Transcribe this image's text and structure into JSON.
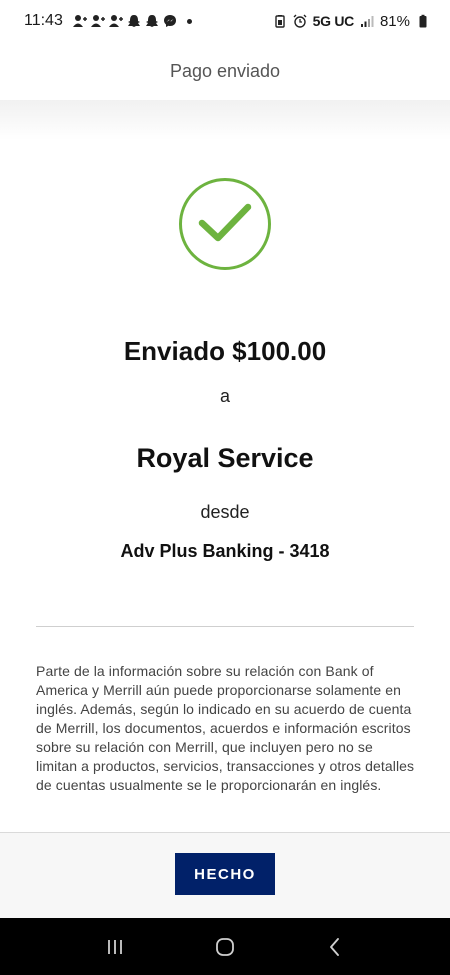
{
  "status_bar": {
    "time": "11:43",
    "network": "5G UC",
    "battery": "81%",
    "notification_icons": [
      "person-add-icon",
      "person-add-icon",
      "person-add-icon",
      "snapchat-icon",
      "snapchat-icon",
      "messenger-icon"
    ]
  },
  "header": {
    "title": "Pago enviado"
  },
  "confirmation": {
    "icon": "checkmark-circle-icon",
    "sent_amount": "Enviado $100.00",
    "to_word": "a",
    "recipient": "Royal Service",
    "from_word": "desde",
    "account": "Adv Plus Banking - 3418"
  },
  "disclaimer": "Parte de la información sobre su relación con Bank of America y Merrill aún puede proporcionarse solamente en inglés. Además, según lo indicado en su acuerdo de cuenta de Merrill, los documentos, acuerdos e información escritos sobre su relación con Merrill, que incluyen pero no se limitan a productos, servicios, transacciones y otros detalles de cuentas usualmente se le proporcionarán en inglés.",
  "actions": {
    "done_label": "HECHO"
  },
  "nav": {
    "icons": [
      "recents-icon",
      "home-icon",
      "back-icon"
    ]
  },
  "colors": {
    "accent": "#012169",
    "success": "#6db33f"
  }
}
